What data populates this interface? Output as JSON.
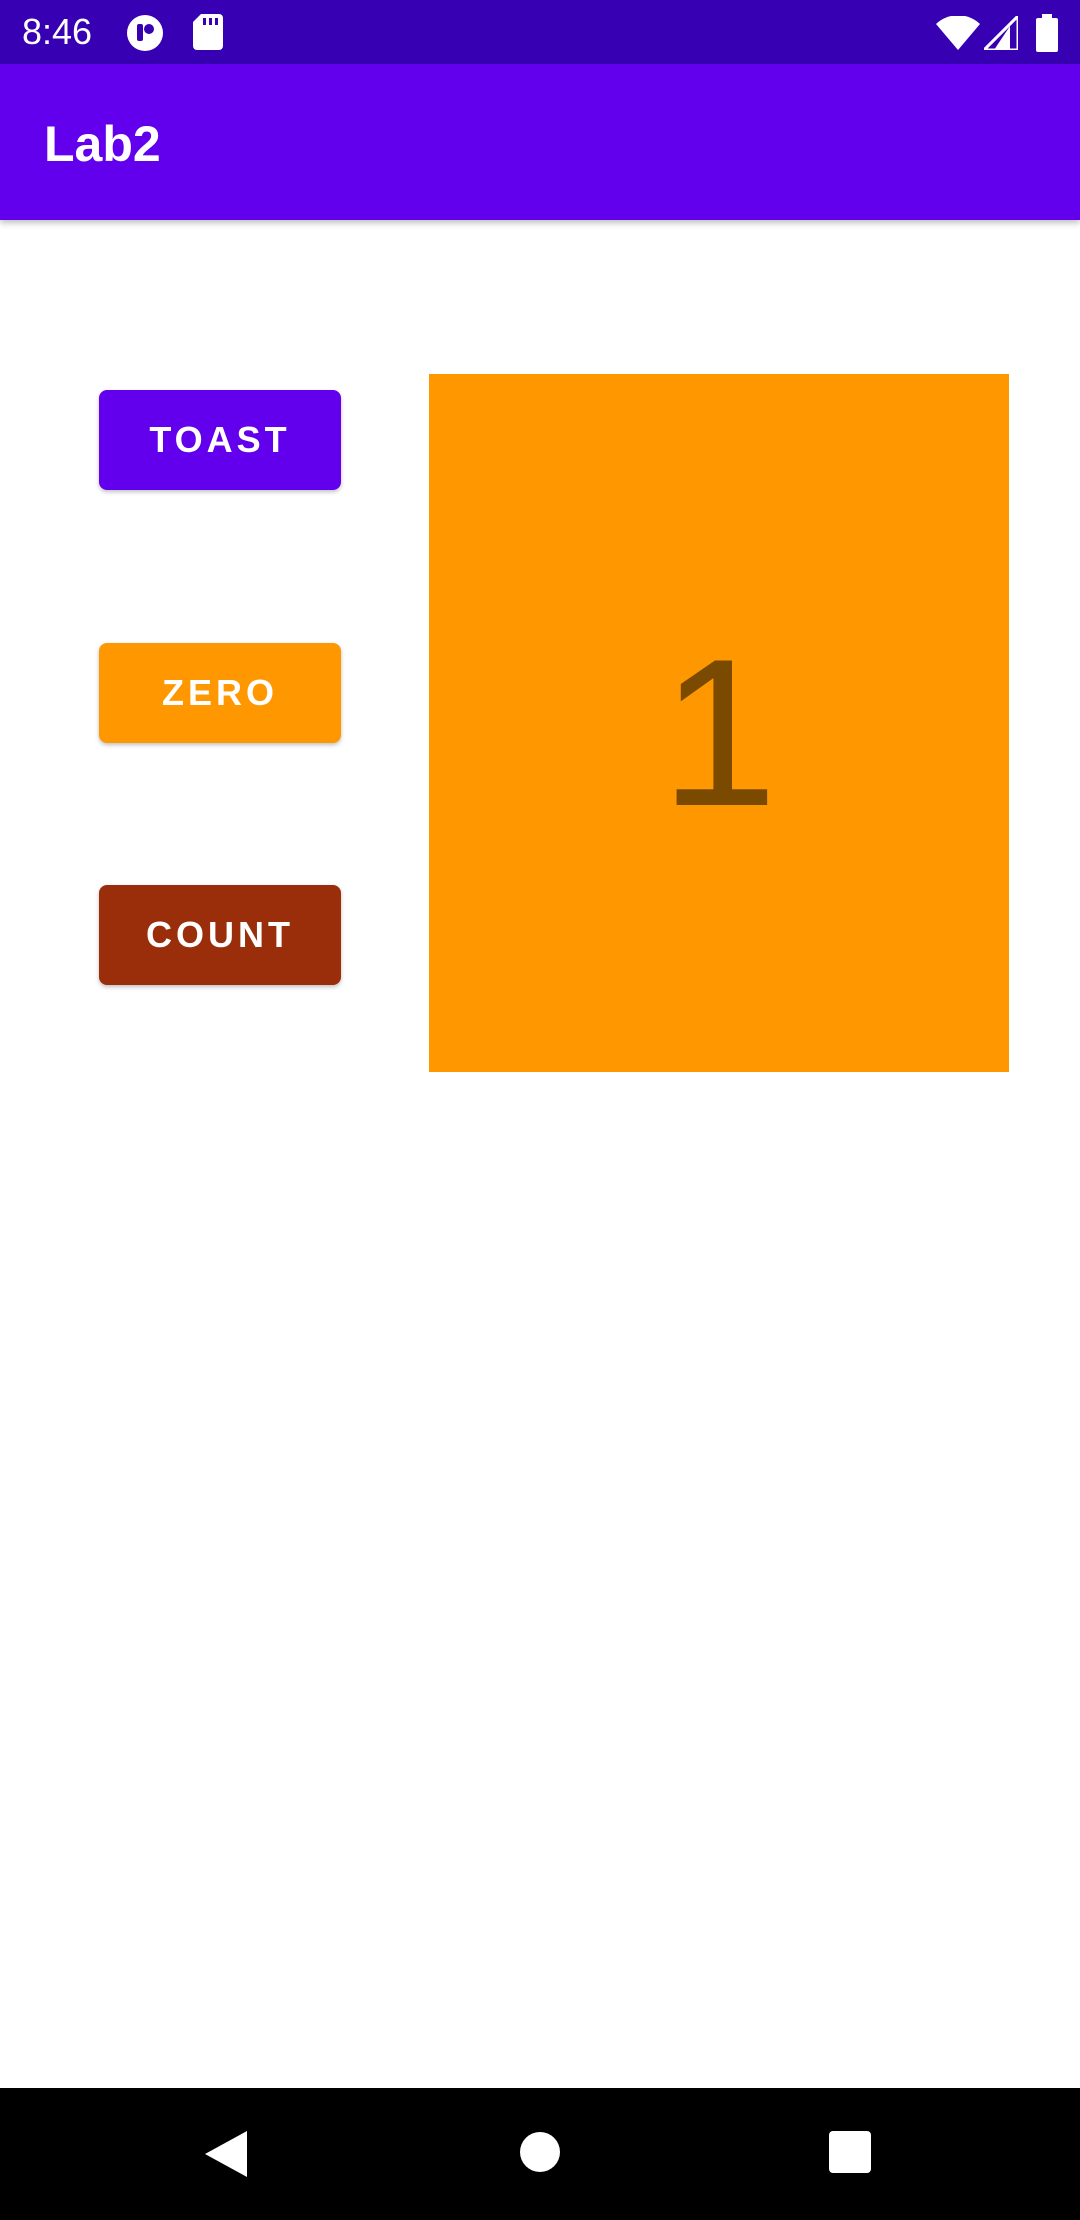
{
  "status_bar": {
    "time": "8:46",
    "background": "#3700B3",
    "icons": [
      "app-notification-icon",
      "sd-card-icon",
      "wifi-icon",
      "signal-icon",
      "battery-icon"
    ]
  },
  "app_bar": {
    "title": "Lab2",
    "background": "#6200EE"
  },
  "buttons": {
    "toast": {
      "label": "TOAST",
      "color": "#6200EE"
    },
    "zero": {
      "label": "ZERO",
      "color": "#FF9800"
    },
    "count": {
      "label": "COUNT",
      "color": "#9A2E0A"
    }
  },
  "counter": {
    "value": "1",
    "background": "#FF9800",
    "text_color": "#7A4A00"
  },
  "nav_bar": {
    "icons": [
      "back-icon",
      "home-icon",
      "recents-icon"
    ]
  }
}
